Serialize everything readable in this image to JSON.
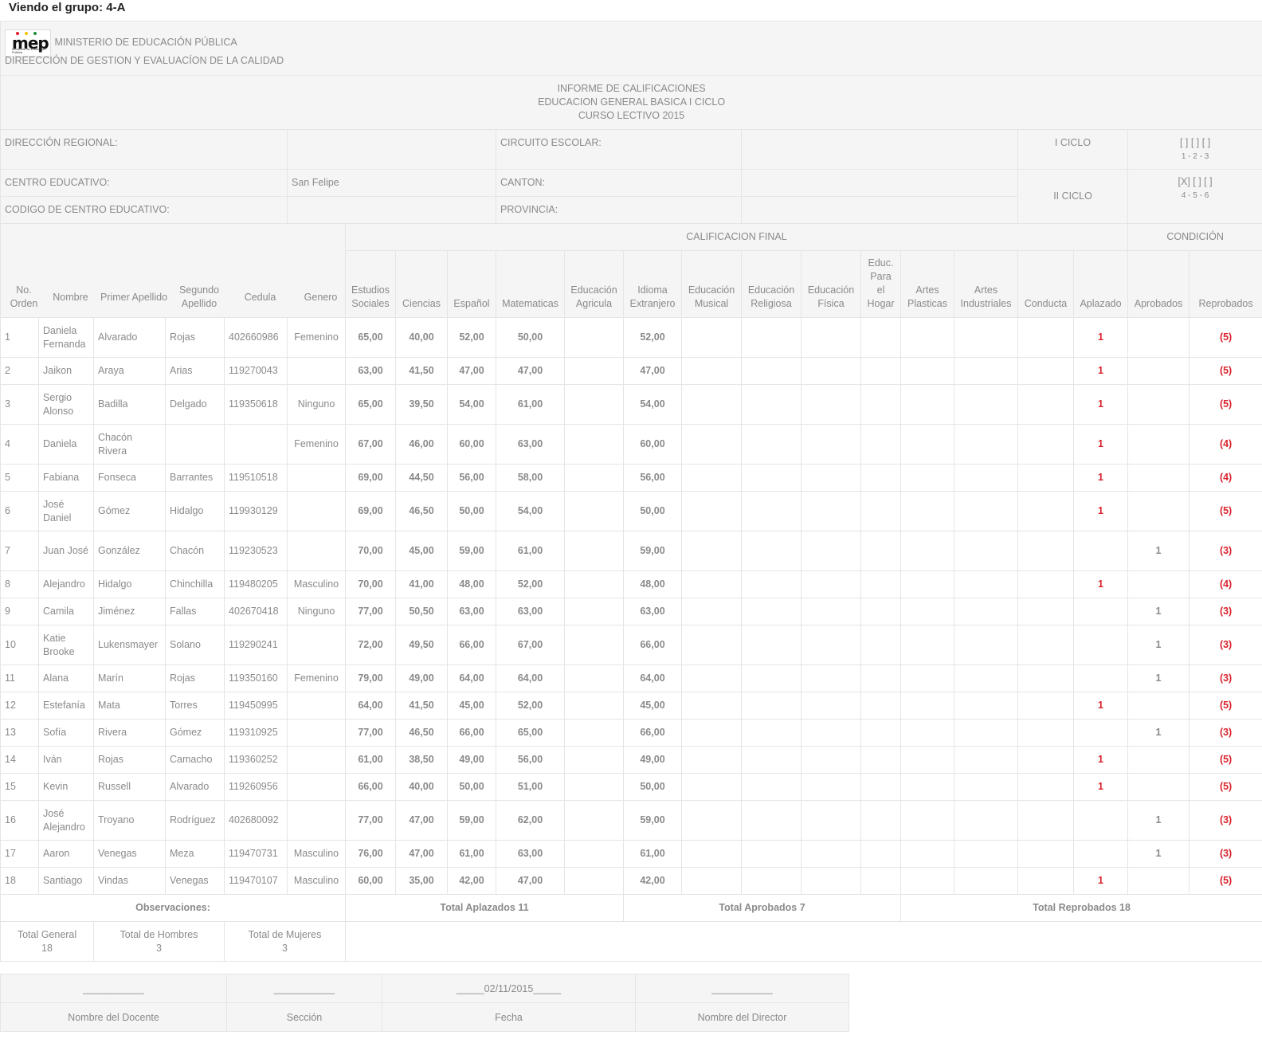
{
  "page_title": "Viendo el grupo: 4-A",
  "header": {
    "logo_word": "mep",
    "logo_sub": "Ministerio de Educación Pública",
    "ministry": "MINISTERIO DE EDUCACIÓN PÚBLICA",
    "direction": "DIREECCIÓN DE GESTION Y EVALUACÍON DE LA CALIDAD",
    "report_title": "INFORME DE CALIFICACIONES",
    "report_level": "EDUCACION GENERAL BASICA I CICLO",
    "report_year": "CURSO LECTIVO 2015"
  },
  "info": {
    "regional_label": "DIRECCIÓN REGIONAL:",
    "regional_value": "",
    "circuito_label": "CIRCUITO ESCOLAR:",
    "circuito_value": "",
    "ciclo1_label": "I CICLO",
    "ciclo1_marks": "[ ] [ ] [ ]",
    "ciclo1_grades": "1 - 2 - 3",
    "centro_label": "CENTRO EDUCATIVO:",
    "centro_value": "San Felipe",
    "canton_label": "CANTON:",
    "canton_value": "",
    "ciclo2_label": "II CICLO",
    "ciclo2_marks": "[X] [ ] [ ]",
    "ciclo2_grades": "4 - 5 - 6",
    "codigo_label": "CODIGO DE CENTRO EDUCATIVO:",
    "codigo_value": "",
    "provincia_label": "PROVINCIA:",
    "provincia_value": ""
  },
  "groups": {
    "calificacion": "CALIFICACION FINAL",
    "condicion": "CONDICIÓN"
  },
  "columns": {
    "orden": "No. Orden",
    "nombre": "Nombre",
    "primer": "Primer Apellido",
    "segundo": "Segundo Apellido",
    "cedula": "Cedula",
    "genero": "Genero",
    "sociales": "Estudios Sociales",
    "ciencias": "Ciencias",
    "espanol": "Español",
    "matematicas": "Matematicas",
    "agricola": "Educación Agricula",
    "idioma": "Idioma Extranjero",
    "musical": "Educación Musical",
    "religiosa": "Educación Religiosa",
    "fisica": "Educación Física",
    "hogar": "Educ. Para el Hogar",
    "plasticas": "Artes Plasticas",
    "industriales": "Artes Industriales",
    "conducta": "Conducta",
    "aplazado": "Aplazado",
    "aprobados": "Aprobados",
    "reprobados": "Reprobados"
  },
  "students": [
    {
      "n": "1",
      "nombre": "Daniela Fernanda",
      "ap1": "Alvarado",
      "ap2": "Rojas",
      "cedula": "402660986",
      "genero": "Femenino",
      "soc": "65,00",
      "cie": "40,00",
      "esp": "52,00",
      "mat": "50,00",
      "idi": "52,00",
      "apl": "1",
      "apr": "",
      "rep": "(5)"
    },
    {
      "n": "2",
      "nombre": "Jaikon",
      "ap1": "Araya",
      "ap2": "Arias",
      "cedula": "119270043",
      "genero": "",
      "soc": "63,00",
      "cie": "41,50",
      "esp": "47,00",
      "mat": "47,00",
      "idi": "47,00",
      "apl": "1",
      "apr": "",
      "rep": "(5)"
    },
    {
      "n": "3",
      "nombre": "Sergio Alonso",
      "ap1": "Badilla",
      "ap2": "Delgado",
      "cedula": "119350618",
      "genero": "Ninguno",
      "soc": "65,00",
      "cie": "39,50",
      "esp": "54,00",
      "mat": "61,00",
      "idi": "54,00",
      "apl": "1",
      "apr": "",
      "rep": "(5)"
    },
    {
      "n": "4",
      "nombre": "Daniela",
      "ap1": "Chacón Rivera",
      "ap2": "",
      "cedula": "",
      "genero": "Femenino",
      "soc": "67,00",
      "cie": "46,00",
      "esp": "60,00",
      "mat": "63,00",
      "idi": "60,00",
      "apl": "1",
      "apr": "",
      "rep": "(4)"
    },
    {
      "n": "5",
      "nombre": "Fabiana",
      "ap1": "Fonseca",
      "ap2": "Barrantes",
      "cedula": "119510518",
      "genero": "",
      "soc": "69,00",
      "cie": "44,50",
      "esp": "56,00",
      "mat": "58,00",
      "idi": "56,00",
      "apl": "1",
      "apr": "",
      "rep": "(4)"
    },
    {
      "n": "6",
      "nombre": "José Daniel",
      "ap1": "Gómez",
      "ap2": "Hidalgo",
      "cedula": "119930129",
      "genero": "",
      "soc": "69,00",
      "cie": "46,50",
      "esp": "50,00",
      "mat": "54,00",
      "idi": "50,00",
      "apl": "1",
      "apr": "",
      "rep": "(5)"
    },
    {
      "n": "7",
      "nombre": "Juan José",
      "ap1": "González",
      "ap2": "Chacón",
      "cedula": "119230523",
      "genero": "",
      "soc": "70,00",
      "cie": "45,00",
      "esp": "59,00",
      "mat": "61,00",
      "idi": "59,00",
      "apl": "",
      "apr": "1",
      "rep": "(3)"
    },
    {
      "n": "8",
      "nombre": "Alejandro",
      "ap1": "Hidalgo",
      "ap2": "Chinchilla",
      "cedula": "119480205",
      "genero": "Masculino",
      "soc": "70,00",
      "cie": "41,00",
      "esp": "48,00",
      "mat": "52,00",
      "idi": "48,00",
      "apl": "1",
      "apr": "",
      "rep": "(4)"
    },
    {
      "n": "9",
      "nombre": "Camila",
      "ap1": "Jiménez",
      "ap2": "Fallas",
      "cedula": "402670418",
      "genero": "Ninguno",
      "soc": "77,00",
      "cie": "50,50",
      "esp": "63,00",
      "mat": "63,00",
      "idi": "63,00",
      "apl": "",
      "apr": "1",
      "rep": "(3)"
    },
    {
      "n": "10",
      "nombre": "Katie Brooke",
      "ap1": "Lukensmayer",
      "ap2": "Solano",
      "cedula": "119290241",
      "genero": "",
      "soc": "72,00",
      "cie": "49,50",
      "esp": "66,00",
      "mat": "67,00",
      "idi": "66,00",
      "apl": "",
      "apr": "1",
      "rep": "(3)"
    },
    {
      "n": "11",
      "nombre": "Alana",
      "ap1": "Marín",
      "ap2": "Rojas",
      "cedula": "119350160",
      "genero": "Femenino",
      "soc": "79,00",
      "cie": "49,00",
      "esp": "64,00",
      "mat": "64,00",
      "idi": "64,00",
      "apl": "",
      "apr": "1",
      "rep": "(3)"
    },
    {
      "n": "12",
      "nombre": "Estefanía",
      "ap1": "Mata",
      "ap2": "Torres",
      "cedula": "119450995",
      "genero": "",
      "soc": "64,00",
      "cie": "41,50",
      "esp": "45,00",
      "mat": "52,00",
      "idi": "45,00",
      "apl": "1",
      "apr": "",
      "rep": "(5)"
    },
    {
      "n": "13",
      "nombre": "Sofía",
      "ap1": "Rivera",
      "ap2": "Gómez",
      "cedula": "119310925",
      "genero": "",
      "soc": "77,00",
      "cie": "46,50",
      "esp": "66,00",
      "mat": "65,00",
      "idi": "66,00",
      "apl": "",
      "apr": "1",
      "rep": "(3)"
    },
    {
      "n": "14",
      "nombre": "Iván",
      "ap1": "Rojas",
      "ap2": "Camacho",
      "cedula": "119360252",
      "genero": "",
      "soc": "61,00",
      "cie": "38,50",
      "esp": "49,00",
      "mat": "56,00",
      "idi": "49,00",
      "apl": "1",
      "apr": "",
      "rep": "(5)"
    },
    {
      "n": "15",
      "nombre": "Kevin",
      "ap1": "Russell",
      "ap2": "Alvarado",
      "cedula": "119260956",
      "genero": "",
      "soc": "66,00",
      "cie": "40,00",
      "esp": "50,00",
      "mat": "51,00",
      "idi": "50,00",
      "apl": "1",
      "apr": "",
      "rep": "(5)"
    },
    {
      "n": "16",
      "nombre": "José Alejandro",
      "ap1": "Troyano",
      "ap2": "Rodríguez",
      "cedula": "402680092",
      "genero": "",
      "soc": "77,00",
      "cie": "47,00",
      "esp": "59,00",
      "mat": "62,00",
      "idi": "59,00",
      "apl": "",
      "apr": "1",
      "rep": "(3)"
    },
    {
      "n": "17",
      "nombre": "Aaron",
      "ap1": "Venegas",
      "ap2": "Meza",
      "cedula": "119470731",
      "genero": "Masculino",
      "soc": "76,00",
      "cie": "47,00",
      "esp": "61,00",
      "mat": "63,00",
      "idi": "61,00",
      "apl": "",
      "apr": "1",
      "rep": "(3)"
    },
    {
      "n": "18",
      "nombre": "Santiago",
      "ap1": "Vindas",
      "ap2": "Venegas",
      "cedula": "119470107",
      "genero": "Masculino",
      "soc": "60,00",
      "cie": "35,00",
      "esp": "42,00",
      "mat": "47,00",
      "idi": "42,00",
      "apl": "1",
      "apr": "",
      "rep": "(5)"
    }
  ],
  "totals": {
    "observaciones": "Observaciones:",
    "aplazados": "Total Aplazados 11",
    "aprobados": "Total Aprobados 7",
    "reprobados": "Total Reprobados 18",
    "general_label": "Total General",
    "general_value": "18",
    "hombres_label": "Total de Hombres",
    "hombres_value": "3",
    "mujeres_label": "Total de Mujeres",
    "mujeres_value": "3"
  },
  "signatures": {
    "docente_line": "___________",
    "seccion_line": "___________",
    "fecha_line": "_____02/11/2015_____",
    "director_line": "___________",
    "docente_label": "Nombre del Docente",
    "seccion_label": "Sección",
    "fecha_label": "Fecha",
    "director_label": "Nombre del Director"
  },
  "colors": {
    "text": "#8a8a8a",
    "header_bg": "#f5f5f5",
    "border": "#e5e5e5",
    "alert": "#d9232d"
  }
}
